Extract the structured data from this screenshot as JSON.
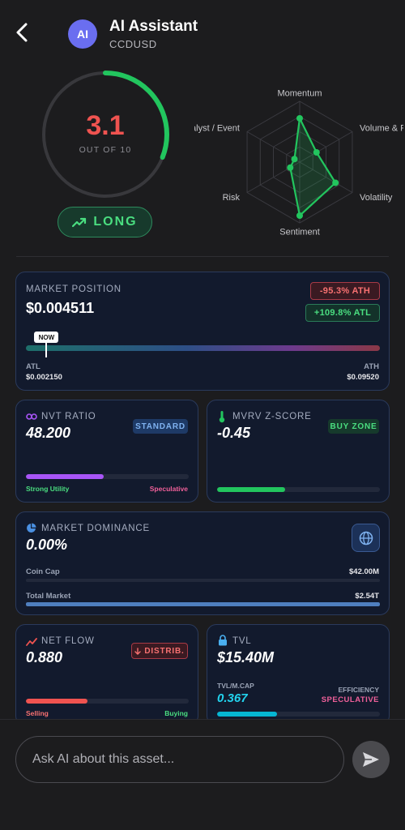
{
  "header": {
    "avatar_text": "AI",
    "title": "AI Assistant",
    "subtitle": "CCDUSD",
    "back_icon": "chevron-left-icon"
  },
  "score": {
    "value": "3.1",
    "subtitle": "OUT OF 10",
    "value_numeric": 3.1,
    "max": 10,
    "color": "#ef5350",
    "ring_color": "#22c55e"
  },
  "signal": {
    "label": "LONG",
    "icon": "trending-up-icon",
    "color": "#4ade80"
  },
  "radar": {
    "axes": [
      "Momentum",
      "Volume & Flow",
      "Volatility",
      "Sentiment",
      "Risk",
      "Catalyst / Event"
    ],
    "values": [
      0.72,
      0.32,
      0.68,
      0.88,
      0.18,
      0.1
    ],
    "color": "#22c55e"
  },
  "market_position": {
    "label": "MARKET POSITION",
    "value": "$0.004511",
    "ath_badge": "-95.3% ATH",
    "atl_badge": "+109.8% ATL",
    "now_label": "NOW",
    "now_fraction": 0.058,
    "atl_label": "ATL",
    "atl_value": "$0.002150",
    "ath_label": "ATH",
    "ath_value": "$0.09520"
  },
  "nvt": {
    "label": "NVT RATIO",
    "value": "48.200",
    "badge": "STANDARD",
    "fill_fraction": 0.48,
    "left_label": "Strong Utility",
    "right_label": "Speculative",
    "icon": "link-icon"
  },
  "mvrv": {
    "label": "MVRV Z-SCORE",
    "value": "-0.45",
    "badge": "BUY ZONE",
    "fill_fraction": 0.42,
    "icon": "thermometer-icon"
  },
  "dominance": {
    "label": "MARKET DOMINANCE",
    "value": "0.00%",
    "icon": "pie-chart-icon",
    "globe_icon": "globe-icon",
    "coin_cap_label": "Coin Cap",
    "coin_cap_value": "$42.00M",
    "coin_cap_fraction": 0.0,
    "total_market_label": "Total Market",
    "total_market_value": "$2.54T",
    "total_market_fraction": 1.0
  },
  "net_flow": {
    "label": "NET FLOW",
    "value": "0.880",
    "badge": "DISTRIB.",
    "badge_icon": "arrow-down-icon",
    "fill_fraction": 0.38,
    "left_label": "Selling",
    "right_label": "Buying",
    "icon": "trend-chart-icon"
  },
  "tvl": {
    "label": "TVL",
    "value": "$15.40M",
    "icon": "lock-icon",
    "ratio_label": "TVL/M.CAP",
    "ratio_value": "0.367",
    "efficiency_label": "EFFICIENCY",
    "efficiency_value": "SPECULATIVE",
    "fill_fraction": 0.37
  },
  "chat": {
    "placeholder": "Ask AI about this asset...",
    "send_icon": "send-icon"
  },
  "colors": {
    "background": "#1c1c1e",
    "card_bg": "#121a2d",
    "card_border": "#2a3a5c",
    "green": "#22c55e",
    "red": "#ef5350",
    "purple": "#a855f7",
    "blue": "#4a90e2",
    "teal": "#06b6d4"
  }
}
